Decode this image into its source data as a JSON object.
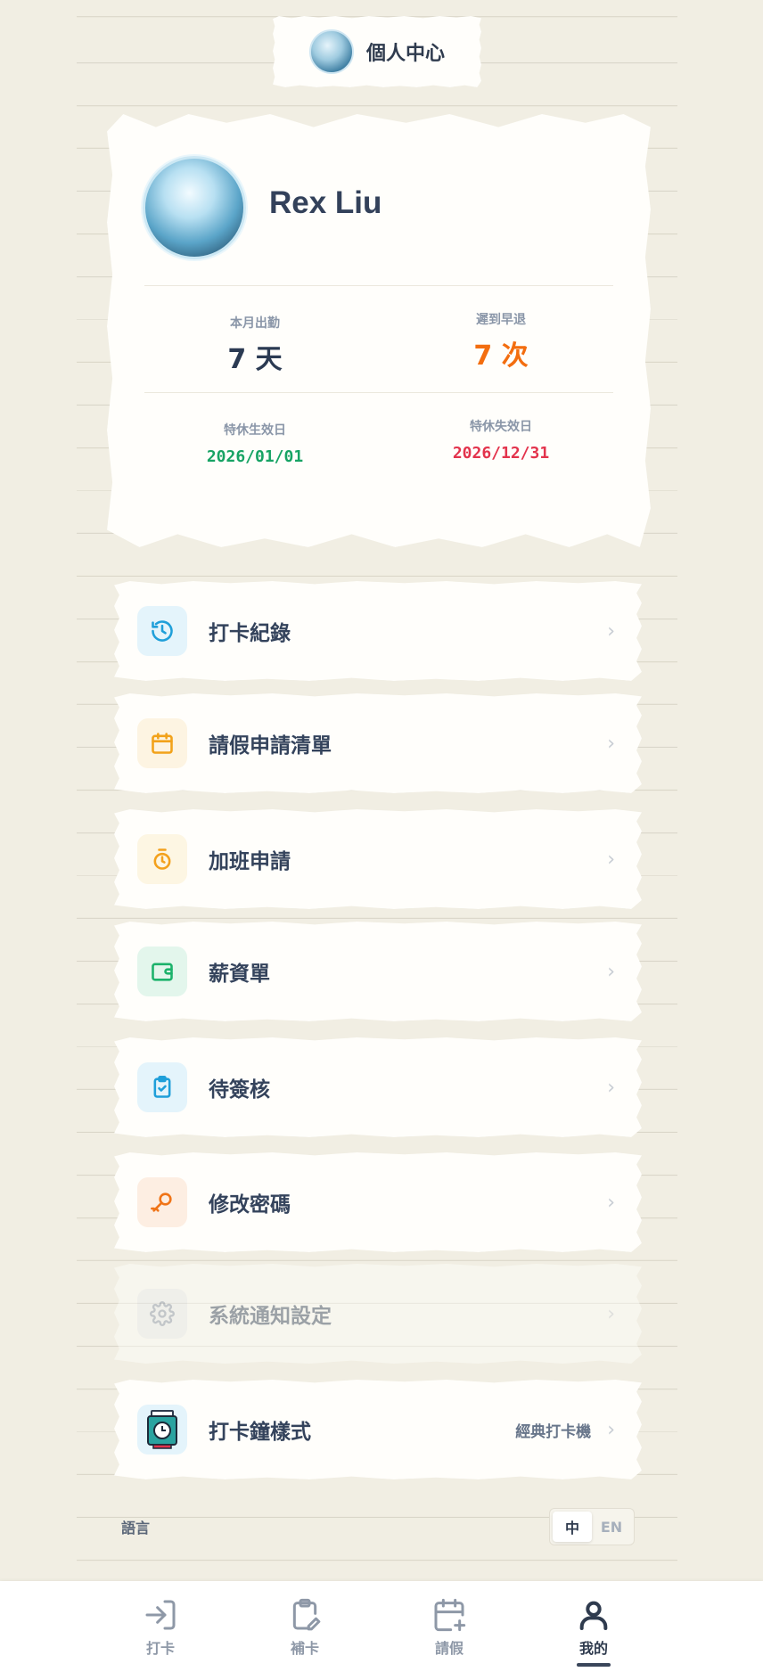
{
  "header": {
    "title": "個人中心"
  },
  "profile": {
    "name": "Rex Liu",
    "stats": [
      {
        "label": "本月出勤",
        "value": "7 天",
        "color": "#2b3a52"
      },
      {
        "label": "遲到早退",
        "value": "7 次",
        "color": "#f36d0f"
      }
    ],
    "leave": [
      {
        "label": "特休生效日",
        "value": "2026/01/01",
        "color": "#17a364"
      },
      {
        "label": "特休失效日",
        "value": "2026/12/31",
        "color": "#e3334c"
      }
    ]
  },
  "menu": [
    {
      "label": "打卡紀錄",
      "icon": "history-icon",
      "color": "#1f9fd9"
    },
    {
      "label": "請假申請清單",
      "icon": "calendar-icon",
      "color": "#f2a21a"
    },
    {
      "label": "加班申請",
      "icon": "stopwatch-icon",
      "color": "#f3a11d"
    },
    {
      "label": "薪資單",
      "icon": "wallet-icon",
      "color": "#1cb26b"
    },
    {
      "label": "待簽核",
      "icon": "clipboard-check-icon",
      "color": "#1f9fd9"
    },
    {
      "label": "修改密碼",
      "icon": "key-icon",
      "color": "#f07417"
    },
    {
      "label": "系統通知設定",
      "icon": "gear-icon",
      "color": "#8a96a8"
    },
    {
      "label": "打卡鐘樣式",
      "icon": "time-clock-icon",
      "value": "經典打卡機",
      "color": "#2aa3a0"
    }
  ],
  "language": {
    "label": "語言",
    "options": [
      "中",
      "EN"
    ],
    "selected": "中"
  },
  "bottom_nav": [
    {
      "label": "打卡",
      "icon": "login-icon"
    },
    {
      "label": "補卡",
      "icon": "clipboard-edit-icon"
    },
    {
      "label": "請假",
      "icon": "calendar-plus-icon"
    },
    {
      "label": "我的",
      "icon": "user-icon",
      "active": true
    }
  ]
}
